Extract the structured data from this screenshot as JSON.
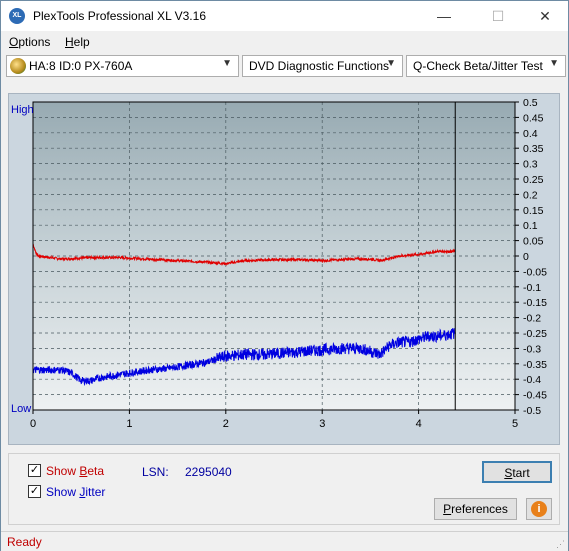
{
  "app": {
    "title": "PlexTools Professional XL V3.16",
    "icon_text": "XL"
  },
  "window_controls": {
    "minimize": "—",
    "maximize": "☐",
    "close": "✕"
  },
  "menu": {
    "options": {
      "first": "O",
      "rest": "ptions"
    },
    "help": {
      "first": "H",
      "rest": "elp"
    }
  },
  "toolbar": {
    "drive": "HA:8 ID:0  PX-760A",
    "function": "DVD Diagnostic Functions",
    "test": "Q-Check Beta/Jitter Test"
  },
  "chart_data": {
    "type": "line",
    "background": "#a8b9c0",
    "left_labels": {
      "high": "High",
      "low": "Low"
    },
    "x_ticks": [
      "0",
      "1",
      "2",
      "3",
      "4",
      "5"
    ],
    "xlim": [
      0,
      5
    ],
    "y_ticks": [
      "0.5",
      "0.45",
      "0.4",
      "0.35",
      "0.3",
      "0.25",
      "0.2",
      "0.15",
      "0.1",
      "0.05",
      "0",
      "-0.05",
      "-0.1",
      "-0.15",
      "-0.2",
      "-0.25",
      "-0.3",
      "-0.35",
      "-0.4",
      "-0.45",
      "-0.5"
    ],
    "ylim": [
      -0.5,
      0.5
    ],
    "end_marker_x": 4.38,
    "grid": true,
    "series": [
      {
        "color": "#e00000",
        "x": [
          0,
          0.03,
          0.06,
          0.3,
          0.6,
          0.9,
          1.2,
          1.5,
          1.8,
          2.0,
          2.2,
          2.5,
          2.8,
          3.0,
          3.3,
          3.5,
          3.6,
          3.8,
          4.0,
          4.2,
          4.38
        ],
        "y": [
          0.04,
          0.01,
          0.0,
          -0.01,
          -0.005,
          -0.005,
          -0.01,
          -0.015,
          -0.02,
          -0.025,
          -0.015,
          -0.012,
          -0.012,
          -0.015,
          -0.01,
          -0.01,
          -0.015,
          0.0,
          0.005,
          0.015,
          0.015
        ]
      },
      {
        "color": "#0000e0",
        "x": [
          0,
          0.1,
          0.2,
          0.3,
          0.4,
          0.5,
          0.6,
          0.7,
          0.8,
          0.9,
          1.0,
          1.2,
          1.4,
          1.6,
          1.8,
          2.0,
          2.2,
          2.4,
          2.6,
          2.8,
          3.0,
          3.2,
          3.4,
          3.5,
          3.6,
          3.7,
          3.8,
          3.9,
          4.0,
          4.1,
          4.2,
          4.3,
          4.38
        ],
        "y": [
          -0.37,
          -0.37,
          -0.37,
          -0.37,
          -0.38,
          -0.405,
          -0.405,
          -0.395,
          -0.39,
          -0.385,
          -0.38,
          -0.37,
          -0.365,
          -0.355,
          -0.345,
          -0.325,
          -0.32,
          -0.32,
          -0.315,
          -0.31,
          -0.305,
          -0.3,
          -0.3,
          -0.31,
          -0.32,
          -0.29,
          -0.28,
          -0.28,
          -0.27,
          -0.26,
          -0.26,
          -0.255,
          -0.25
        ]
      }
    ]
  },
  "options": {
    "show_beta": {
      "pre": "Show ",
      "key": "B",
      "post": "eta",
      "checked": true
    },
    "show_jitter": {
      "pre": "Show ",
      "key": "J",
      "post": "itter",
      "checked": true
    }
  },
  "lsn": {
    "label": "LSN:",
    "value": "2295040"
  },
  "buttons": {
    "start": {
      "key": "S",
      "rest": "tart"
    },
    "preferences": {
      "key": "P",
      "rest": "references"
    },
    "info_icon": "i"
  },
  "status": {
    "text": "Ready"
  }
}
